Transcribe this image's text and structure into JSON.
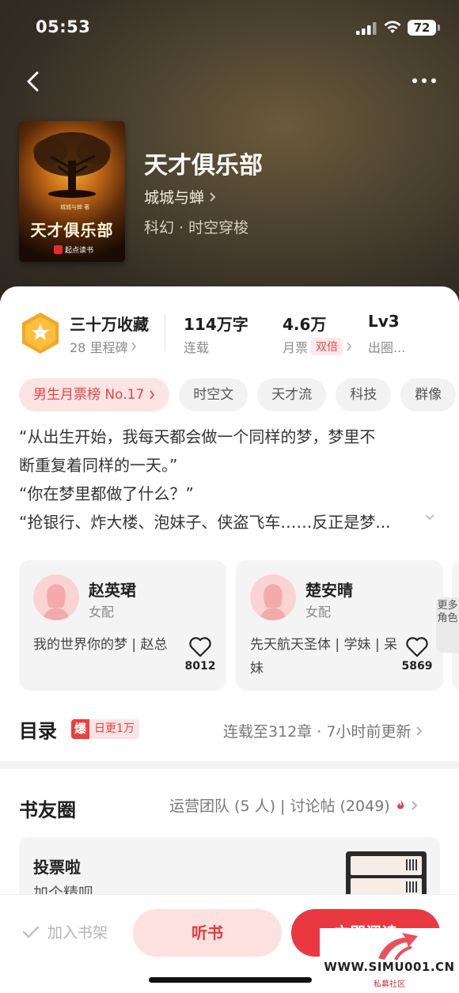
{
  "status_bar": {
    "time": "05:53",
    "battery": "72"
  },
  "book": {
    "title": "天才俱乐部",
    "author": "城城与蝉",
    "genre": "科幻 · 时空穿梭",
    "cover": {
      "title": "天才俱乐部",
      "author_line": "城城与蝉 著",
      "publisher": "起点读书"
    }
  },
  "stats": {
    "favorites": {
      "main": "三十万收藏",
      "sub": "28 里程碑"
    },
    "words": {
      "main": "114万字",
      "sub": "连载"
    },
    "tickets": {
      "main": "4.6万",
      "sub": "月票",
      "badge": "双倍"
    },
    "level": {
      "main": "Lv3",
      "sub": "出圈..."
    }
  },
  "tags": {
    "rank": "男生月票榜 No.17",
    "items": [
      "时空文",
      "天才流",
      "科技",
      "群像"
    ]
  },
  "synopsis": {
    "lines": [
      "“从出生开始，我每天都会做一个同样的梦，梦里不",
      "断重复着同样的一天。”",
      "“你在梦里都做了什么？”",
      "“抢银行、炸大楼、泡妹子、侠盗飞车……反正是梦..."
    ]
  },
  "characters": [
    {
      "name": "赵英珺",
      "role": "女配",
      "desc": "我的世界你的梦 | 赵总",
      "likes": "8012"
    },
    {
      "name": "楚安晴",
      "role": "女配",
      "desc": "先天航天圣体 | 学妹 | 呆妹",
      "likes": "5869"
    }
  ],
  "more_roles": "更多角色",
  "catalog": {
    "title": "目录",
    "badge_icon": "爆",
    "badge_text": "日更1万",
    "info": "连载至312章 · 7小时前更新"
  },
  "club": {
    "title": "书友圈",
    "info": "运营团队 (5 人) | 讨论帖 (2049)"
  },
  "vote": {
    "title": "投票啦",
    "subtitle": "加个精呗"
  },
  "bottom": {
    "shelf": "加入书架",
    "listen": "听书",
    "read": "立即阅读"
  },
  "watermark": {
    "site": "WWW.SIMU001.CN",
    "name": "私募社区"
  },
  "colors": {
    "accent": "#e9383f",
    "accent_light": "#fde0e0",
    "hero_bg": "#3a3227",
    "badge_gold": "#f5a623"
  }
}
